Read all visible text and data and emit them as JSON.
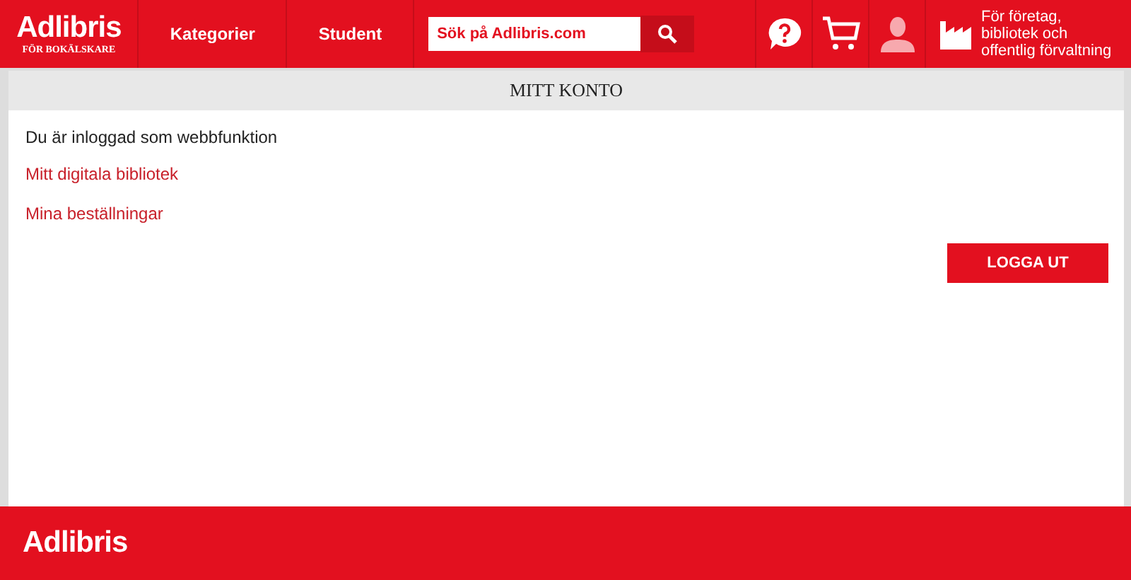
{
  "header": {
    "logo": "Adlibris",
    "tagline": "FÖR BOKÄLSKARE",
    "nav": [
      "Kategorier",
      "Student"
    ],
    "search": {
      "placeholder": "Sök på Adlibris.com"
    },
    "business_link": "För företag, bibliotek och offentlig förvaltning"
  },
  "account": {
    "title": "MITT KONTO",
    "status": "Du är inloggad som webbfunktion",
    "links": [
      "Mitt digitala bibliotek",
      "Mina beställningar"
    ],
    "logout": "LOGGA UT"
  },
  "footer": {
    "logo": "Adlibris"
  }
}
